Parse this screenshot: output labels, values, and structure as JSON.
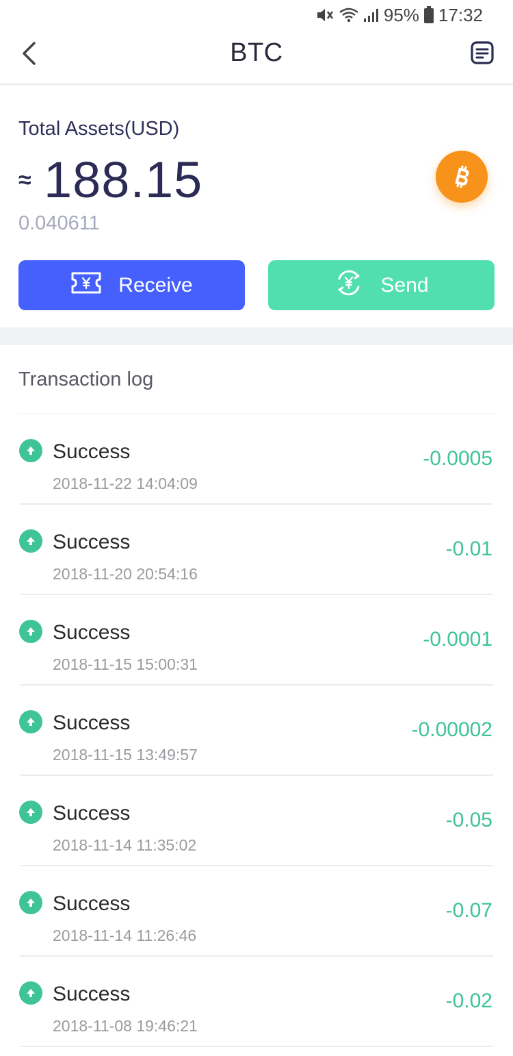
{
  "status_bar": {
    "battery": "95%",
    "time": "17:32",
    "icons": [
      "mute-icon",
      "wifi-icon",
      "signal-icon",
      "battery-icon"
    ]
  },
  "nav": {
    "title": "BTC",
    "back_icon": "chevron-left-icon",
    "record_icon": "record-icon"
  },
  "assets": {
    "label": "Total Assets(USD)",
    "approx": "≈",
    "value": "188.15",
    "coin_amount": "0.040611",
    "coin_icon": "bitcoin-icon",
    "receive_label": "Receive",
    "send_label": "Send",
    "colors": {
      "receive": "#4560fc",
      "send": "#52dfb0",
      "bitcoin": "#f7931a",
      "positive": "#3ec496"
    }
  },
  "transactions": {
    "title": "Transaction log",
    "items": [
      {
        "status": "Success",
        "time": "2018-11-22 14:04:09",
        "amount": "-0.0005"
      },
      {
        "status": "Success",
        "time": "2018-11-20 20:54:16",
        "amount": "-0.01"
      },
      {
        "status": "Success",
        "time": "2018-11-15 15:00:31",
        "amount": "-0.0001"
      },
      {
        "status": "Success",
        "time": "2018-11-15 13:49:57",
        "amount": "-0.00002"
      },
      {
        "status": "Success",
        "time": "2018-11-14 11:35:02",
        "amount": "-0.05"
      },
      {
        "status": "Success",
        "time": "2018-11-14 11:26:46",
        "amount": "-0.07"
      },
      {
        "status": "Success",
        "time": "2018-11-08 19:46:21",
        "amount": "-0.02"
      }
    ]
  }
}
